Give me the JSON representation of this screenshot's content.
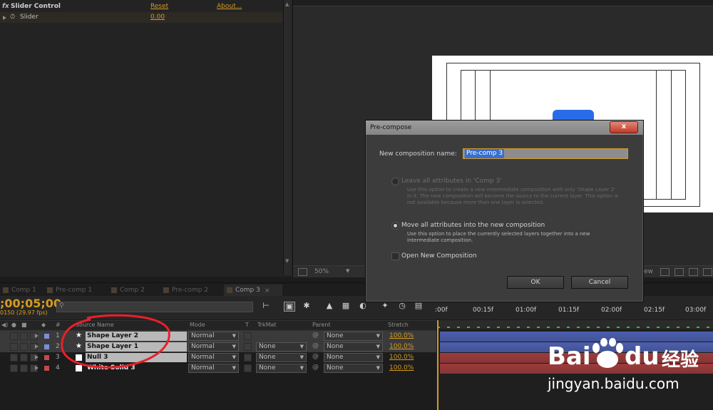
{
  "effects": {
    "fx_badge": "fx",
    "effect_name": "Slider Control",
    "reset_label": "Reset",
    "about_label": "About...",
    "param_name": "Slider",
    "param_value": "0.00"
  },
  "viewer": {
    "zoom": "50%",
    "partial_label": "ew"
  },
  "tabs": [
    {
      "label": "Comp 1"
    },
    {
      "label": "Pre-comp 1"
    },
    {
      "label": "Comp 2"
    },
    {
      "label": "Pre-comp 2"
    },
    {
      "label": "Comp 3"
    }
  ],
  "timeline": {
    "timecode": ";00;05;00",
    "fps": "0150 (29.97 fps)",
    "ruler": [
      ":00f",
      "00:15f",
      "01:00f",
      "01:15f",
      "02:00f",
      "02:15f",
      "03:00f"
    ],
    "columns": {
      "num": "#",
      "source": "Source Name",
      "mode": "Mode",
      "t": "T",
      "trkmat": "TrkMat",
      "parent": "Parent",
      "stretch": "Stretch"
    },
    "layers": [
      {
        "num": "1",
        "name": "Shape Layer 2",
        "mode": "Normal",
        "trkmat": "",
        "parent": "None",
        "stretch": "100.0%",
        "label_color": "#7b8fd6",
        "bar_color": "#4c5fb0",
        "icon": "star-icon"
      },
      {
        "num": "2",
        "name": "Shape Layer 1",
        "mode": "Normal",
        "trkmat": "None",
        "parent": "None",
        "stretch": "100.0%",
        "label_color": "#7b8fd6",
        "bar_color": "#4c5fb0",
        "icon": "star-icon"
      },
      {
        "num": "3",
        "name": "Null 3",
        "mode": "Normal",
        "trkmat": "None",
        "parent": "None",
        "stretch": "100.0%",
        "label_color": "#c24a4a",
        "bar_color": "#9e3b3b",
        "icon": "solid-icon"
      },
      {
        "num": "4",
        "name": "White Solid 3",
        "mode": "Normal",
        "trkmat": "None",
        "parent": "None",
        "stretch": "100.0%",
        "label_color": "#c24a4a",
        "bar_color": "#9e3b3b",
        "icon": "solid-icon"
      }
    ]
  },
  "dialog": {
    "title": "Pre-compose",
    "close_label": "x",
    "name_label": "New composition name:",
    "name_value": "Pre-comp 3",
    "option1_label": "Leave all attributes in 'Comp 3'",
    "option1_desc": "Use this option to create a new intermediate composition with only 'Shape Layer 2' in it. The new composition will become the source to the current layer. This option is not available because more than one layer is selected.",
    "option2_label": "Move all attributes into the new composition",
    "option2_desc": "Use this option to place the currently selected layers together into a new intermediate composition.",
    "open_label": "Open New Composition",
    "ok_label": "OK",
    "cancel_label": "Cancel"
  },
  "watermark": {
    "brand_left": "Bai",
    "brand_right": "du",
    "brand_cn": "经验",
    "url": "jingyan.baidu.com"
  },
  "colors": {
    "accent": "#d59b22",
    "selection": "#3a6fd2",
    "annotation": "#e8202a"
  }
}
